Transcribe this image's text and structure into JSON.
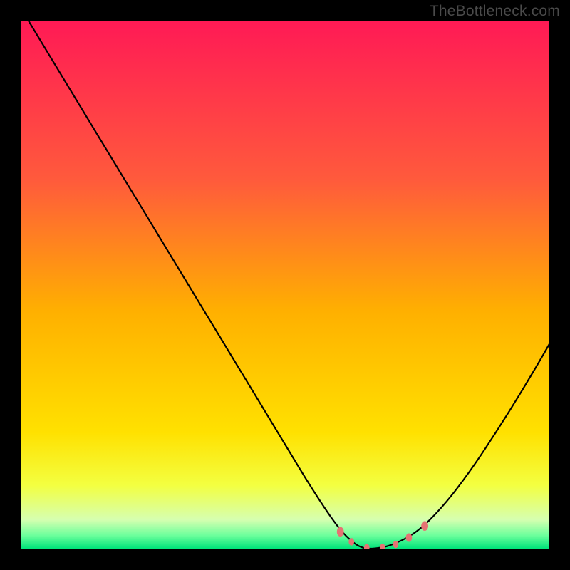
{
  "watermark": "TheBottleneck.com",
  "chart_data": {
    "type": "line",
    "title": "",
    "xlabel": "",
    "ylabel": "",
    "xlim": [
      0,
      100
    ],
    "ylim": [
      0,
      100
    ],
    "grid": false,
    "legend": false,
    "background_gradient_stops": [
      {
        "offset": 0.0,
        "color": "#ff1a55"
      },
      {
        "offset": 0.3,
        "color": "#ff5a3c"
      },
      {
        "offset": 0.55,
        "color": "#ffb000"
      },
      {
        "offset": 0.78,
        "color": "#ffe100"
      },
      {
        "offset": 0.88,
        "color": "#f3ff41"
      },
      {
        "offset": 0.945,
        "color": "#d6ffb0"
      },
      {
        "offset": 0.975,
        "color": "#6cff9c"
      },
      {
        "offset": 1.0,
        "color": "#00e47a"
      }
    ],
    "series": [
      {
        "name": "bottleneck-curve",
        "x": [
          -1,
          10,
          20,
          30,
          40,
          50,
          55,
          60,
          63,
          65,
          67,
          70,
          75,
          80,
          85,
          90,
          95,
          100,
          101
        ],
        "y": [
          104,
          85.8,
          69.3,
          52.8,
          36.3,
          19.8,
          11.5,
          4.0,
          1.0,
          0.0,
          0.0,
          0.5,
          3.0,
          8.0,
          14.5,
          22.0,
          30.0,
          38.5,
          40.5
        ],
        "stroke": "#000000",
        "stroke_width": 2.2
      }
    ],
    "markers": [
      {
        "x": 60.5,
        "y": 3.2,
        "color": "#e57373",
        "size": 9
      },
      {
        "x": 62.6,
        "y": 1.3,
        "color": "#e57373",
        "size": 7
      },
      {
        "x": 65.5,
        "y": 0.2,
        "color": "#e57373",
        "size": 7
      },
      {
        "x": 68.5,
        "y": 0.2,
        "color": "#e57373",
        "size": 7
      },
      {
        "x": 71.0,
        "y": 0.8,
        "color": "#e57373",
        "size": 7
      },
      {
        "x": 73.5,
        "y": 2.1,
        "color": "#e57373",
        "size": 8
      },
      {
        "x": 76.5,
        "y": 4.3,
        "color": "#e57373",
        "size": 9
      }
    ]
  }
}
